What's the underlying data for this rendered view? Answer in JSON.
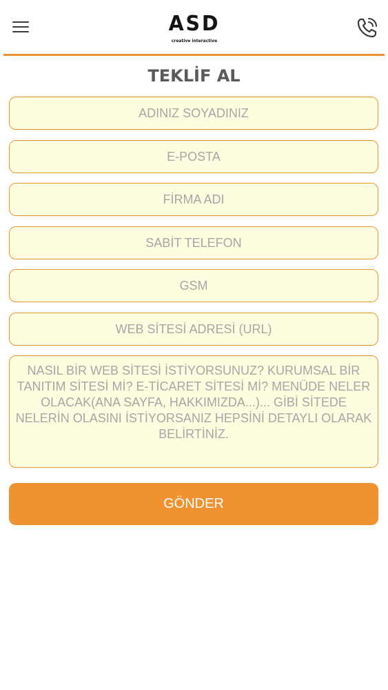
{
  "header": {
    "logo_text": "ASD",
    "logo_subtext": "creative interactive"
  },
  "page_title": "TEKLİF AL",
  "form": {
    "name_placeholder": "ADINIZ SOYADINIZ",
    "email_placeholder": "E-POSTA",
    "company_placeholder": "FİRMA ADI",
    "landline_placeholder": "SABİT TELEFON",
    "gsm_placeholder": "GSM",
    "website_placeholder": "WEB SİTESİ ADRESİ (URL)",
    "details_placeholder": "NASIL BİR WEB SİTESİ İSTİYORSUNUZ? KURUMSAL BİR TANITIM SİTESİ Mİ? E-TİCARET SİTESİ Mİ? MENÜDE NELER OLACAK(ANA SAYFA, HAKKIMIZDA...)... GİBİ SİTEDE NELERİN OLASINI İSTİYORSANIZ HEPSİNİ DETAYLI OLARAK BELİRTİNİZ.",
    "submit_label": "GÖNDER"
  },
  "icons": {
    "menu": "hamburger-menu-icon",
    "phone": "phone-icon"
  },
  "colors": {
    "accent": "#f0922f",
    "field_background": "#fffde0",
    "field_border": "#e8962f",
    "placeholder_text": "#a6a6a6",
    "title_text": "#5a5a5a"
  }
}
